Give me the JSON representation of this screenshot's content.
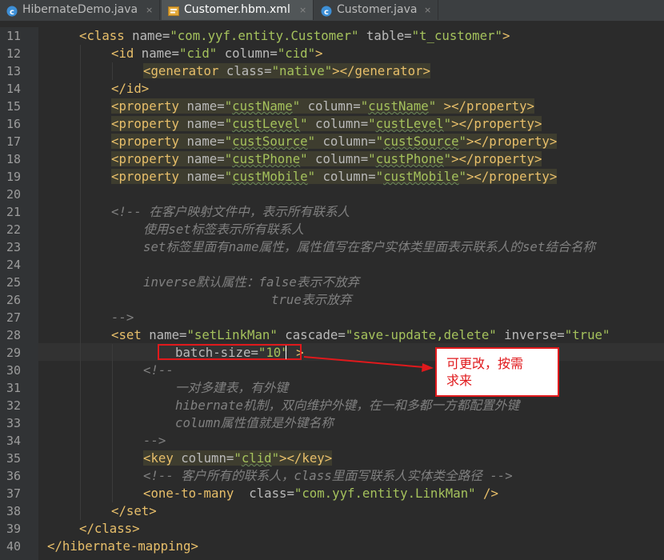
{
  "tabs": [
    {
      "label": "HibernateDemo.java",
      "icon": "java-class-icon",
      "active": false
    },
    {
      "label": "Customer.hbm.xml",
      "icon": "xml-file-icon",
      "active": true
    },
    {
      "label": "Customer.java",
      "icon": "java-class-icon",
      "active": false
    }
  ],
  "tab_close_glyph": "×",
  "colors": {
    "editor_bg": "#2b2b2b",
    "tag": "#e8bf6a",
    "attr_name": "#bababa",
    "attr_value": "#a5c25c",
    "comment": "#808080",
    "annotation": "#e0191c"
  },
  "line_numbers": [
    "11",
    "12",
    "13",
    "14",
    "15",
    "16",
    "17",
    "18",
    "19",
    "20",
    "21",
    "22",
    "23",
    "24",
    "25",
    "26",
    "27",
    "28",
    "29",
    "30",
    "31",
    "32",
    "33",
    "34",
    "35",
    "36",
    "37",
    "38",
    "39",
    "40"
  ],
  "code": {
    "l11": [
      "<class ",
      "name=",
      "\"com.yyf.entity.Customer\"",
      " table=",
      "\"t_customer\"",
      ">"
    ],
    "l12": [
      "<id ",
      "name=",
      "\"cid\"",
      " column=",
      "\"cid\"",
      ">"
    ],
    "l13": [
      "<generator ",
      "class=",
      "\"native\"",
      "></generator>"
    ],
    "l14": [
      "</id>"
    ],
    "l15": [
      "<property ",
      "name=",
      "\"",
      "custName",
      "\"",
      " column=",
      "\"",
      "custName",
      "\"",
      " ></property>"
    ],
    "l16": [
      "<property ",
      "name=",
      "\"",
      "custLevel",
      "\"",
      " column=",
      "\"",
      "custLevel",
      "\"",
      "></property>"
    ],
    "l17": [
      "<property ",
      "name=",
      "\"",
      "custSource",
      "\"",
      " column=",
      "\"",
      "custSource",
      "\"",
      "></property>"
    ],
    "l18": [
      "<property ",
      "name=",
      "\"",
      "custPhone",
      "\"",
      " column=",
      "\"",
      "custPhone",
      "\"",
      "></property>"
    ],
    "l19": [
      "<property ",
      "name=",
      "\"",
      "custMobile",
      "\"",
      " column=",
      "\"",
      "custMobile",
      "\"",
      "></property>"
    ],
    "l21": "<!-- 在客户映射文件中，表示所有联系人",
    "l22": "使用set标签表示所有联系人",
    "l23": "set标签里面有name属性，属性值写在客户实体类里面表示联系人的set结合名称",
    "l25": "inverse默认属性：false表示不放弃",
    "l26": "true表示放弃",
    "l27": "-->",
    "l28": [
      "<set ",
      "name=",
      "\"setLinkMan\"",
      " cascade=",
      "\"save-update,delete\"",
      " inverse=",
      "\"true\""
    ],
    "l29": [
      "batch-size=",
      "\"10\"",
      " >"
    ],
    "l30": "<!--",
    "l31": "一对多建表，有外键",
    "l32": "hibernate机制，双向维护外键，在一和多都一方都配置外键",
    "l33": "column属性值就是外键名称",
    "l34": "-->",
    "l35": [
      "<key ",
      "column=",
      "\"",
      "clid",
      "\"",
      "></key>"
    ],
    "l36": "<!-- 客户所有的联系人，class里面写联系人实体类全路径 -->",
    "l37": [
      "<one-to-many  ",
      "class=",
      "\"com.yyf.entity.LinkMan\"",
      " />"
    ],
    "l38": [
      "</set>"
    ],
    "l39": [
      "</class>"
    ],
    "l40": [
      "</hibernate-mapping>"
    ]
  },
  "annotation": {
    "text_line1": "可更改，按需",
    "text_line2": "求来"
  }
}
